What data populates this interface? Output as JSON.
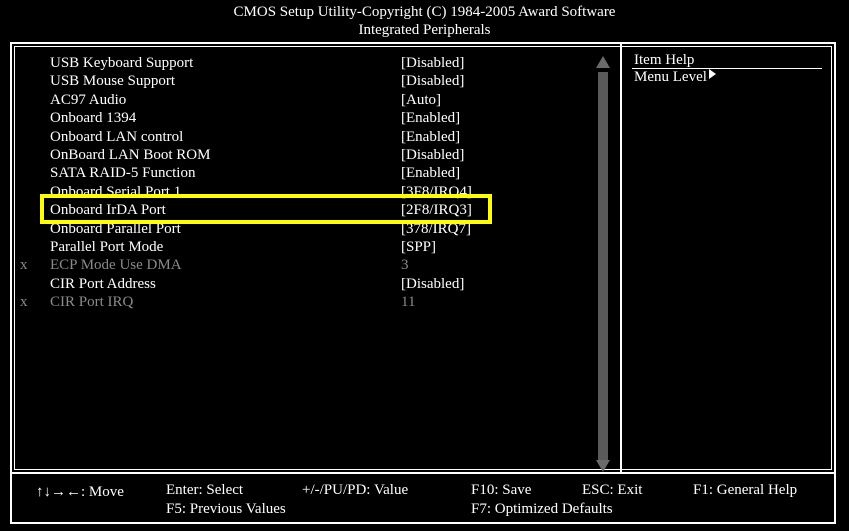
{
  "title": {
    "line1": "CMOS Setup Utility-Copyright (C) 1984-2005 Award Software",
    "line2": "Integrated Peripherals"
  },
  "items": [
    {
      "mark": "",
      "label": "USB Keyboard Support",
      "value": "[Disabled]",
      "enabled": true
    },
    {
      "mark": "",
      "label": "USB Mouse Support",
      "value": "[Disabled]",
      "enabled": true
    },
    {
      "mark": "",
      "label": "AC97 Audio",
      "value": "[Auto]",
      "enabled": true
    },
    {
      "mark": "",
      "label": "Onboard 1394",
      "value": "[Enabled]",
      "enabled": true
    },
    {
      "mark": "",
      "label": "Onboard LAN control",
      "value": "[Enabled]",
      "enabled": true
    },
    {
      "mark": "",
      "label": "OnBoard LAN Boot ROM",
      "value": "[Disabled]",
      "enabled": true
    },
    {
      "mark": "",
      "label": "SATA RAID-5 Function",
      "value": "[Enabled]",
      "enabled": true
    },
    {
      "mark": "",
      "label": "Onboard Serial Port 1",
      "value": "[3F8/IRQ4]",
      "enabled": true
    },
    {
      "mark": "",
      "label": "Onboard IrDA Port",
      "value": "[2F8/IRQ3]",
      "enabled": true
    },
    {
      "mark": "",
      "label": "Onboard Parallel Port",
      "value": "[378/IRQ7]",
      "enabled": true
    },
    {
      "mark": "",
      "label": "Parallel Port Mode",
      "value": "[SPP]",
      "enabled": true
    },
    {
      "mark": "x",
      "label": "ECP Mode Use DMA",
      "value": "3",
      "enabled": false
    },
    {
      "mark": "",
      "label": "CIR Port Address",
      "value": "[Disabled]",
      "enabled": true
    },
    {
      "mark": "x",
      "label": "CIR Port IRQ",
      "value": "11",
      "enabled": false
    }
  ],
  "highlighted_item": "SATA RAID-5 Function",
  "help": {
    "title": "Item Help",
    "menu_level": "Menu Level"
  },
  "footer": {
    "move": "↑↓→←: Move",
    "select": "Enter: Select",
    "value": "+/-/PU/PD: Value",
    "save": "F10: Save",
    "exit": "ESC: Exit",
    "general_help": "F1: General Help",
    "prev_values": "F5: Previous Values",
    "optimized": "F7: Optimized Defaults"
  },
  "colors": {
    "background": "#000000",
    "text": "#ffffff",
    "disabled_text": "#8a8a8a",
    "highlight_border": "#ffff00"
  },
  "icons": {
    "scroll_up": "triangle-up-icon",
    "scroll_down": "triangle-down-icon",
    "submenu": "triangle-right-icon"
  }
}
